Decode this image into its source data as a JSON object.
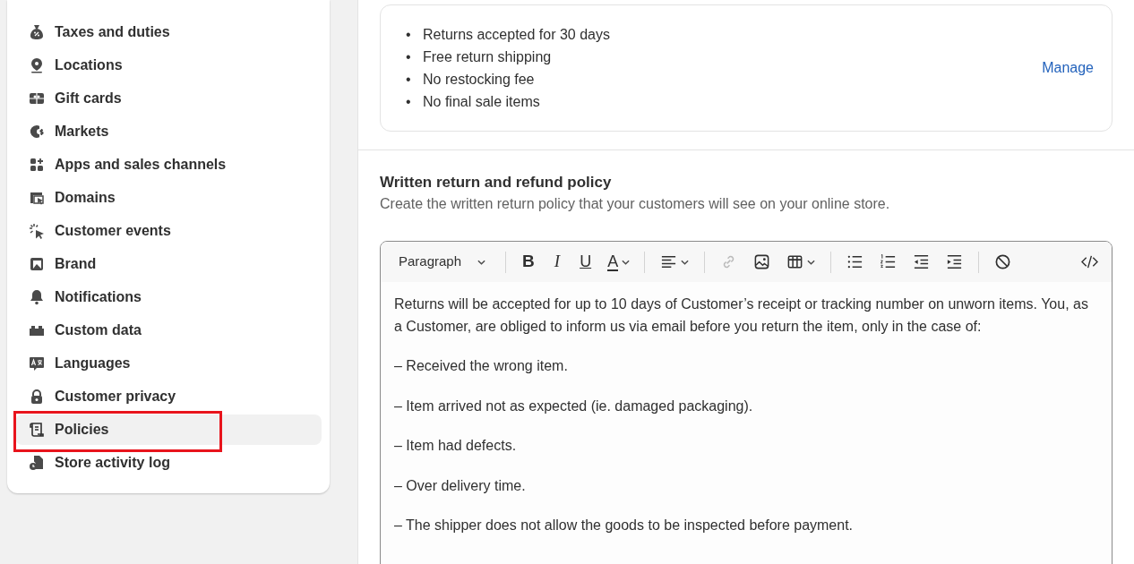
{
  "sidebar": {
    "items": [
      {
        "label": "Taxes and duties",
        "selected": false,
        "highlighted": false
      },
      {
        "label": "Locations",
        "selected": false,
        "highlighted": false
      },
      {
        "label": "Gift cards",
        "selected": false,
        "highlighted": false
      },
      {
        "label": "Markets",
        "selected": false,
        "highlighted": false
      },
      {
        "label": "Apps and sales channels",
        "selected": false,
        "highlighted": false
      },
      {
        "label": "Domains",
        "selected": false,
        "highlighted": false
      },
      {
        "label": "Customer events",
        "selected": false,
        "highlighted": false
      },
      {
        "label": "Brand",
        "selected": false,
        "highlighted": false
      },
      {
        "label": "Notifications",
        "selected": false,
        "highlighted": false
      },
      {
        "label": "Custom data",
        "selected": false,
        "highlighted": false
      },
      {
        "label": "Languages",
        "selected": false,
        "highlighted": false
      },
      {
        "label": "Customer privacy",
        "selected": false,
        "highlighted": false
      },
      {
        "label": "Policies",
        "selected": true,
        "highlighted": true
      },
      {
        "label": "Store activity log",
        "selected": false,
        "highlighted": false
      }
    ]
  },
  "return_rules": {
    "items": [
      {
        "bullet": "•",
        "text": "Returns accepted for 30 days"
      },
      {
        "bullet": "•",
        "text": "Free return shipping"
      },
      {
        "bullet": "•",
        "text": "No restocking fee"
      },
      {
        "bullet": "•",
        "text": "No final sale items"
      }
    ],
    "action": "Manage"
  },
  "written_policy": {
    "title": "Written return and refund policy",
    "description": "Create the written return policy that your customers will see on your online store.",
    "toolbar": [
      {
        "kind": "dropdown",
        "label": "Paragraph"
      },
      {
        "kind": "sep"
      },
      {
        "kind": "bold",
        "label": "B"
      },
      {
        "kind": "italic",
        "label": "I"
      },
      {
        "kind": "underline",
        "label": "U"
      },
      {
        "kind": "color",
        "label": "A"
      },
      {
        "kind": "sep"
      },
      {
        "kind": "align"
      },
      {
        "kind": "sep"
      },
      {
        "kind": "link",
        "disabled": true
      },
      {
        "kind": "image",
        "disabled": false
      },
      {
        "kind": "table"
      },
      {
        "kind": "sep"
      },
      {
        "kind": "bullets"
      },
      {
        "kind": "numbers"
      },
      {
        "kind": "outdent"
      },
      {
        "kind": "indent"
      },
      {
        "kind": "sep"
      },
      {
        "kind": "clear"
      },
      {
        "kind": "code"
      }
    ],
    "content": [
      "Returns will be accepted for up to 10 days of Customer’s receipt or tracking number on unworn items. You, as a Customer, are obliged to inform us via email before you return the item, only in the case of:",
      "–  Received the wrong item.",
      "–  Item arrived not as expected (ie. damaged packaging).",
      "–  Item had defects.",
      "–  Over delivery time.",
      "–  The shipper does not allow the goods to be inspected before payment."
    ]
  }
}
